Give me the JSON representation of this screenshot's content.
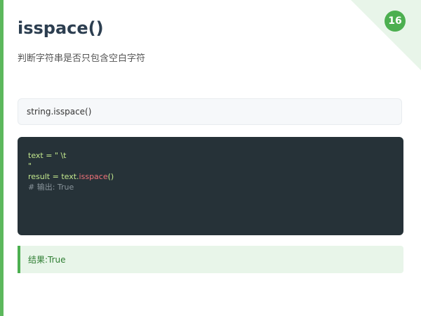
{
  "slide": {
    "number": "16",
    "title": "isspace()",
    "subtitle": "判断字符串是否只包含空白字符"
  },
  "signature": "string.isspace()",
  "code": {
    "line1": "text = \" \\t",
    "line2": "\"",
    "line3_prefix": "result = text.",
    "line3_method": "isspace",
    "line3_suffix": "()",
    "comment": "# 输出: True"
  },
  "result": {
    "label": "结果: ",
    "value": "True"
  },
  "colors": {
    "accent": "#4caf50",
    "code_bg": "#263238",
    "code_text": "#c3e88d",
    "method": "#f07178",
    "result_bg": "#e8f5e9"
  }
}
